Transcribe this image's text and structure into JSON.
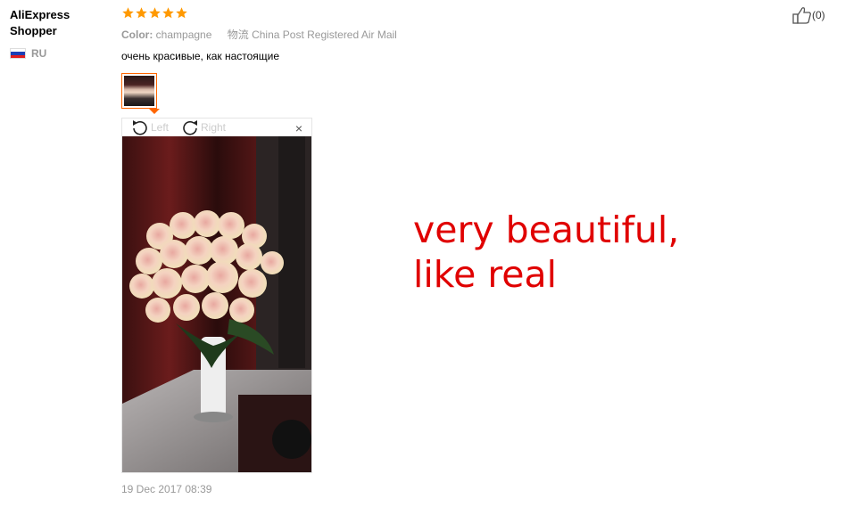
{
  "reviewer": {
    "name": "AliExpress Shopper",
    "country_code": "RU",
    "flag_colors": [
      "#ffffff",
      "#1c3fb6",
      "#e11d1d"
    ]
  },
  "review": {
    "rating": 5,
    "max_rating": 5,
    "star_color": "#f90",
    "color_label": "Color:",
    "color_value": "champagne",
    "logistics_icon": "物流",
    "logistics_value": "China Post Registered Air Mail",
    "text": "очень красивые, как настоящие",
    "date": "19 Dec 2017 08:39"
  },
  "viewer": {
    "rotate_left_label": "Left",
    "rotate_right_label": "Right",
    "close_label": "×"
  },
  "helpful": {
    "count_text": "(0)"
  },
  "annotation": {
    "text": "very beautiful,\nlike real",
    "color": "#e00000"
  },
  "colors": {
    "accent": "#ff6600"
  }
}
